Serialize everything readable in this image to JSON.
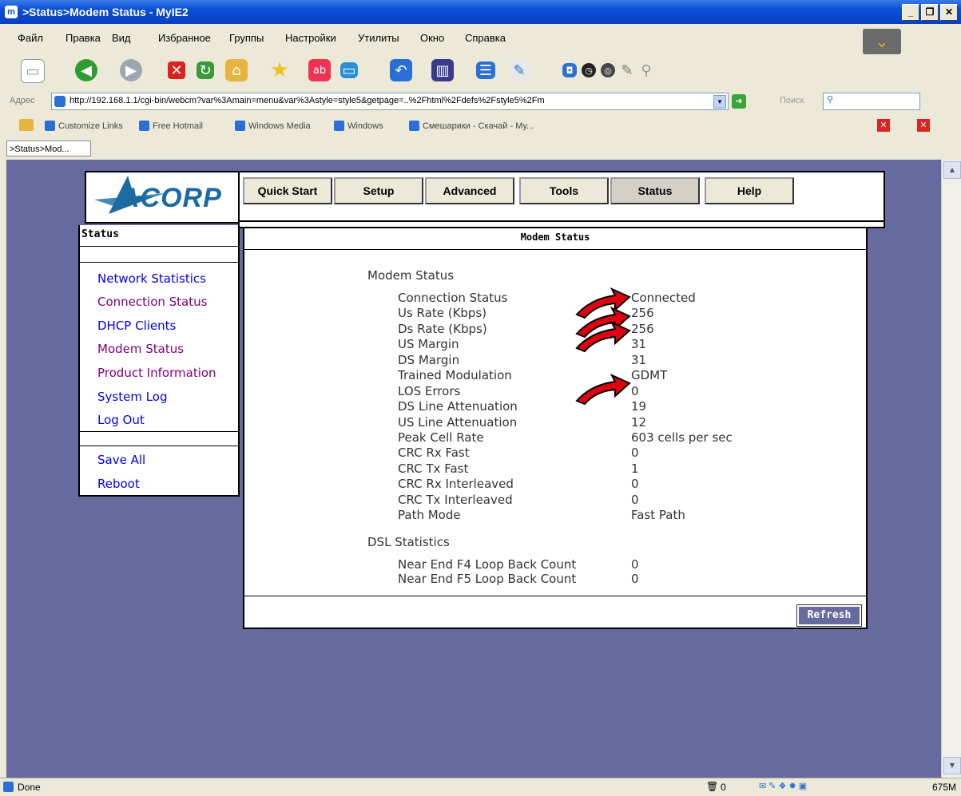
{
  "window": {
    "title": ">Status>Modem Status - MyIE2"
  },
  "menu": [
    "Файл",
    "Правка",
    "Вид",
    "Избранное",
    "Группы",
    "Настройки",
    "Утилиты",
    "Окно",
    "Справка"
  ],
  "address": {
    "label": "Адрес",
    "url": "http://192.168.1.1/cgi-bin/webcm?var%3Amain=menu&var%3Astyle=style5&getpage=..%2Fhtml%2Fdefs%2Fstyle5%2Fm",
    "search_label": "Поиск"
  },
  "links": [
    "Customize Links",
    "Free Hotmail",
    "Windows Media",
    "Windows",
    "Смешарики - Скачай - Му..."
  ],
  "tab": {
    "label": ">Status>Mod..."
  },
  "router": {
    "logo": "ACORP",
    "nav": [
      "Quick Start",
      "Setup",
      "Advanced",
      "Tools",
      "Status",
      "Help"
    ],
    "sidebar": {
      "title": "Status",
      "links": [
        "Network Statistics",
        "Connection Status",
        "DHCP Clients",
        "Modem Status",
        "Product Information",
        "System Log",
        "Log Out"
      ],
      "actions": [
        "Save All",
        "Reboot"
      ]
    },
    "content": {
      "title": "Modem Status",
      "modem_section": "Modem Status",
      "modem_rows": [
        {
          "label": "Connection Status",
          "value": "Connected"
        },
        {
          "label": "Us Rate (Kbps)",
          "value": "256"
        },
        {
          "label": "Ds Rate (Kbps)",
          "value": "256"
        },
        {
          "label": "US Margin",
          "value": "31"
        },
        {
          "label": "DS Margin",
          "value": "31"
        },
        {
          "label": "Trained Modulation",
          "value": "GDMT"
        },
        {
          "label": "LOS Errors",
          "value": "0"
        },
        {
          "label": "DS Line Attenuation",
          "value": "19"
        },
        {
          "label": "US Line Attenuation",
          "value": "12"
        },
        {
          "label": "Peak Cell Rate",
          "value": "603 cells per sec"
        },
        {
          "label": "CRC Rx Fast",
          "value": "0"
        },
        {
          "label": "CRC Tx Fast",
          "value": "1"
        },
        {
          "label": "CRC Rx Interleaved",
          "value": "0"
        },
        {
          "label": "CRC Tx Interleaved",
          "value": "0"
        },
        {
          "label": "Path Mode",
          "value": "Fast Path"
        }
      ],
      "dsl_section": "DSL Statistics",
      "dsl_rows": [
        {
          "label": "Near End F4 Loop Back Count",
          "value": "0"
        },
        {
          "label": "Near End F5 Loop Back Count",
          "value": "0"
        }
      ],
      "refresh_label": "Refresh"
    }
  },
  "status": {
    "text": "Done",
    "count": "0",
    "memory": "675M"
  },
  "colors": {
    "viewport_bg": "#676a9e",
    "visited_link": "#800080",
    "link": "#0000ee",
    "arrow": "#e0000f"
  }
}
